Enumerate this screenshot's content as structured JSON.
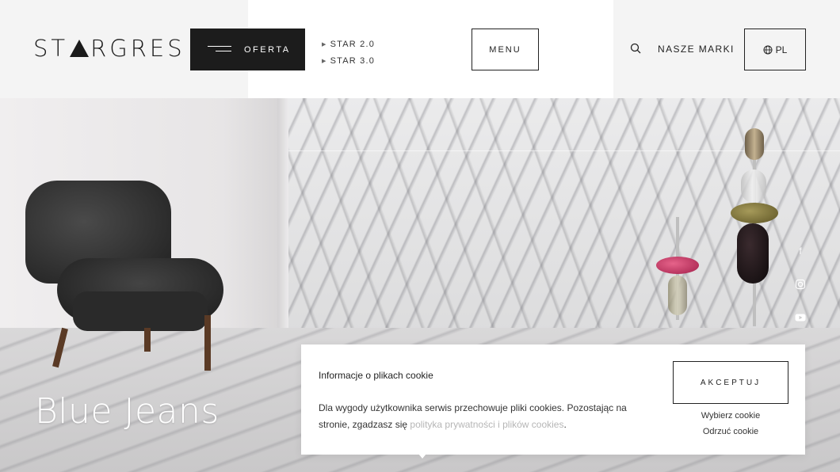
{
  "header": {
    "logo": "STARGRES",
    "oferta_label": "OFERTA",
    "star_links": [
      "STAR 2.0",
      "STAR 3.0"
    ],
    "menu_label": "MENU",
    "nasze_marki_label": "NASZE MARKI",
    "lang_label": "PL"
  },
  "hero": {
    "title": "Blue Jeans",
    "social_icons": [
      "facebook-icon",
      "instagram-icon",
      "youtube-icon"
    ]
  },
  "cookie": {
    "title": "Informacje o plikach cookie",
    "text": "Dla wygody użytkownika serwis przechowuje pliki cookies. Pozostając na stronie, zgadzasz się ",
    "policy_link": "polityka prywatności i plików cookies",
    "text_end": ".",
    "accept_label": "AKCEPTUJ",
    "choose_label": "Wybierz cookie",
    "reject_label": "Odrzuć cookie"
  },
  "colors": {
    "dark": "#1c1c1c",
    "background": "#f4f4f4",
    "white": "#ffffff",
    "muted_link": "#b6b6b6"
  }
}
